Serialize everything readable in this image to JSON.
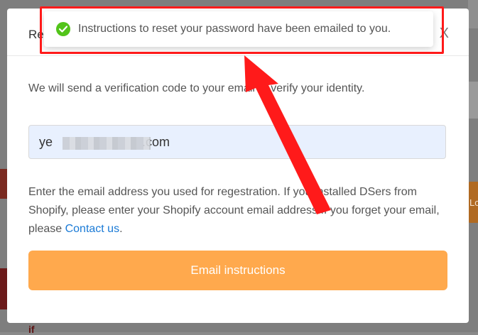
{
  "modal": {
    "title": "Re",
    "close_label": "X",
    "description": "We will send a verification code to your email to verify your identity.",
    "email_value": "ye       .com",
    "help_text": "Enter the email address you used for regestration. If you installed DSers from Shopify, please enter your Shopify account email address If you forget your email, please ",
    "contact_link": "Contact us",
    "help_text_end": ".",
    "submit_label": "Email instructions"
  },
  "toast": {
    "icon": "check-circle-icon",
    "message": "Instructions to reset your password have been emailed to you."
  },
  "background": {
    "right_button_fragment": "Lo",
    "bottom_fragment": "if"
  },
  "colors": {
    "accent": "#ffa94d",
    "link": "#1a7ad6",
    "success": "#52c41a",
    "annotation": "#ff1a1a"
  }
}
